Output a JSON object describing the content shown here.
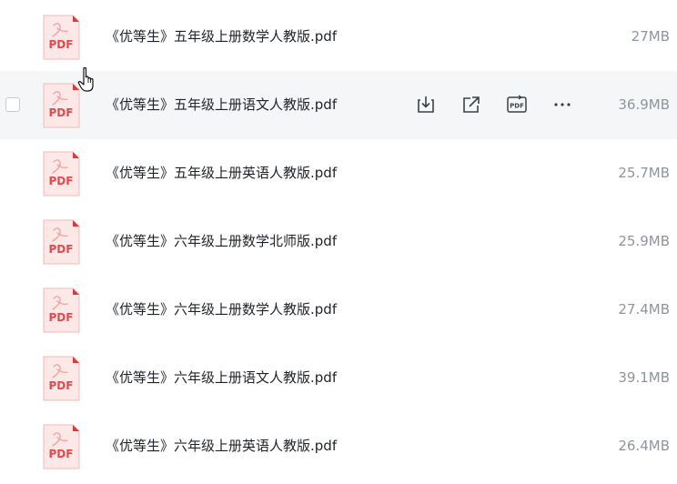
{
  "files": [
    {
      "name": "《优等生》五年级上册数学人教版.pdf",
      "size": "27MB",
      "icon": "pdf-file-icon",
      "icon_text": "PDF"
    },
    {
      "name": "《优等生》五年级上册语文人教版.pdf",
      "size": "36.9MB",
      "icon": "pdf-file-icon",
      "icon_text": "PDF"
    },
    {
      "name": "《优等生》五年级上册英语人教版.pdf",
      "size": "25.7MB",
      "icon": "pdf-file-icon",
      "icon_text": "PDF"
    },
    {
      "name": "《优等生》六年级上册数学北师版.pdf",
      "size": "25.9MB",
      "icon": "pdf-file-icon",
      "icon_text": "PDF"
    },
    {
      "name": "《优等生》六年级上册数学人教版.pdf",
      "size": "27.4MB",
      "icon": "pdf-file-icon",
      "icon_text": "PDF"
    },
    {
      "name": "《优等生》六年级上册语文人教版.pdf",
      "size": "39.1MB",
      "icon": "pdf-file-icon",
      "icon_text": "PDF"
    },
    {
      "name": "《优等生》六年级上册英语人教版.pdf",
      "size": "26.4MB",
      "icon": "pdf-file-icon",
      "icon_text": "PDF"
    }
  ],
  "hovered_row": 1,
  "row_actions": [
    {
      "name": "download-button",
      "icon": "download-icon"
    },
    {
      "name": "share-button",
      "icon": "share-icon"
    },
    {
      "name": "convert-pdf-button",
      "icon": "pdf-convert-icon",
      "label": "PDF"
    },
    {
      "name": "more-button",
      "icon": "more-icon"
    }
  ],
  "colors": {
    "hover_row_bg": "#f5f6f8",
    "pdf_red": "#e8484b",
    "pdf_bg": "#fde8e8",
    "text": "#1f2329",
    "subtext": "#8f959e",
    "icon": "#3b4049"
  }
}
